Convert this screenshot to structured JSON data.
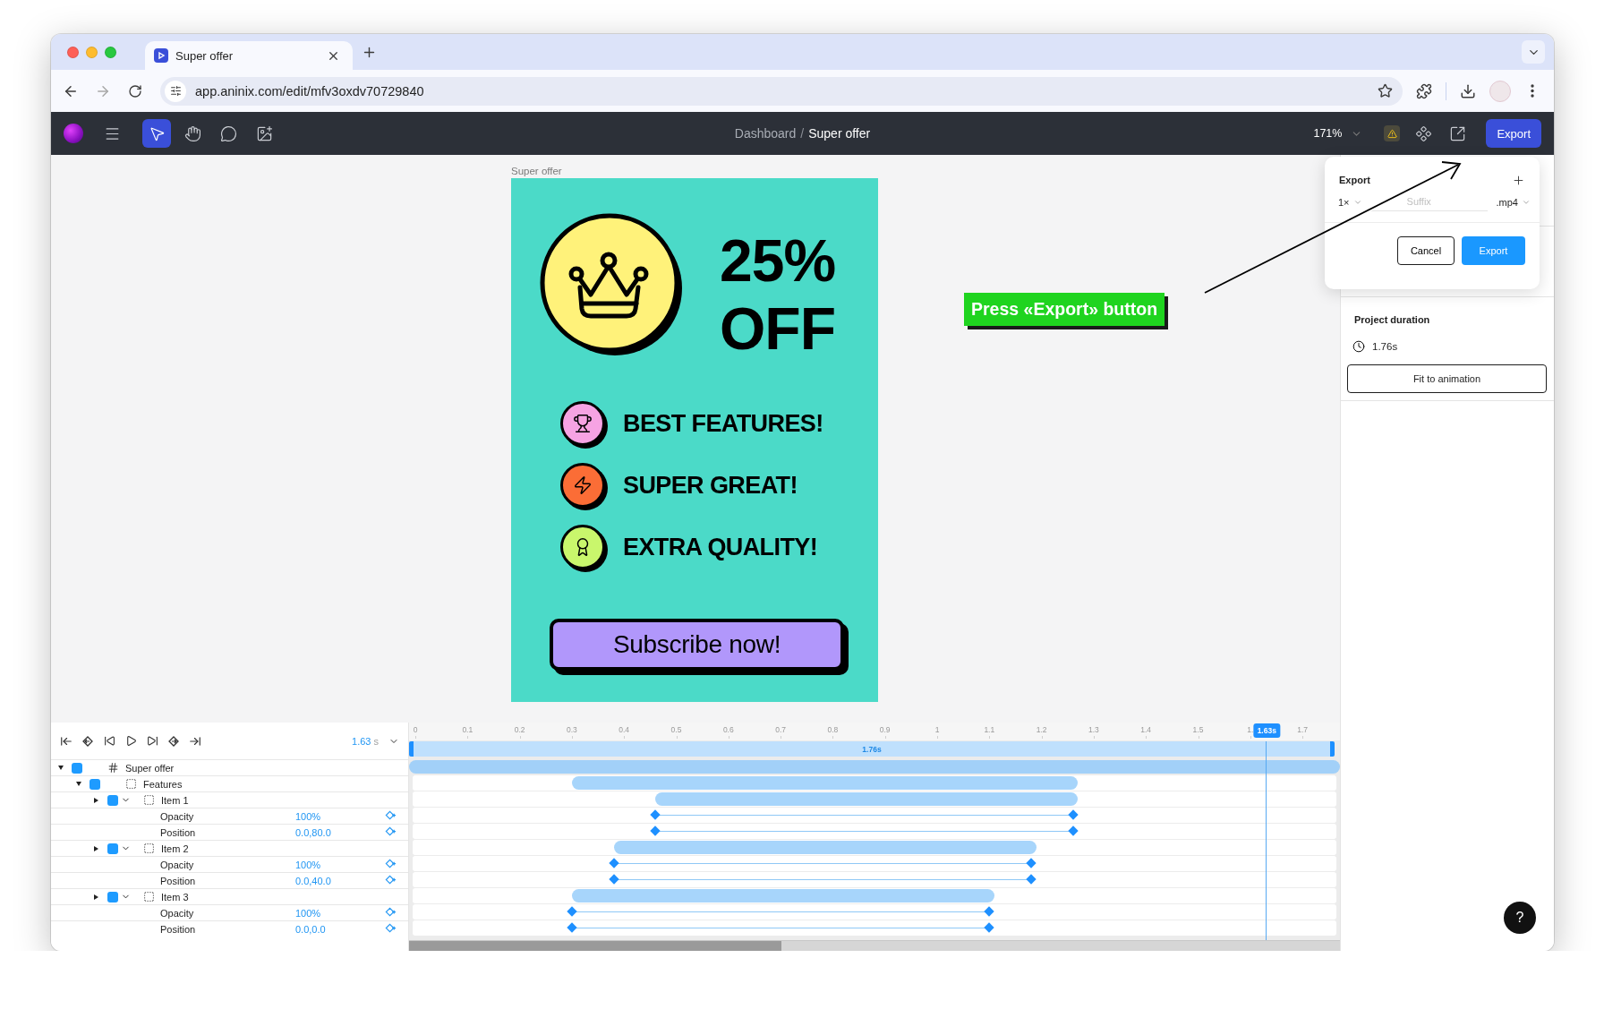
{
  "browser": {
    "tabs": [
      {
        "title": "Super offer",
        "selected": true
      }
    ],
    "forward_disabled": true,
    "url": "app.aninix.com/edit/mfv3oxdv70729840"
  },
  "toolbar": {
    "tools": [
      {
        "kind": "select",
        "selected": true
      },
      {
        "kind": "hand",
        "selected": false
      },
      {
        "kind": "comment",
        "selected": false
      },
      {
        "kind": "image",
        "selected": false
      }
    ],
    "breadcrumb": [
      {
        "label": "Dashboard",
        "selected": false
      },
      {
        "label": "Super offer",
        "selected": true
      }
    ],
    "breadcrumb_separator": "/",
    "zoom": "171%",
    "export_label": "Export"
  },
  "artboard": {
    "label": "Super offer",
    "discount": "25%",
    "off": "OFF",
    "features": [
      {
        "kind": "trophy",
        "text": "BEST FEATURES!",
        "color": "#f6a3e3"
      },
      {
        "kind": "bolt",
        "text": "SUPER GREAT!",
        "color": "#fb6d36"
      },
      {
        "kind": "award",
        "text": "EXTRA QUALITY!",
        "color": "#c9f66c"
      }
    ],
    "cta": "Subscribe now!"
  },
  "annotation": {
    "text": "Press «Export» button"
  },
  "export_popup": {
    "title": "Export",
    "scale": "1×",
    "suffix": {
      "placeholder": "Suffix"
    },
    "format": ".mp4",
    "cancel": "Cancel",
    "confirm": "Export"
  },
  "inspector": {
    "title": "Project duration",
    "duration": "1.76s",
    "button": "Fit to animation"
  },
  "timeline": {
    "current_time": "1.63",
    "time_unit": "s",
    "ruler": [
      "0",
      "0.1",
      "0.2",
      "0.3",
      "0.4",
      "0.5",
      "0.6",
      "0.7",
      "0.8",
      "0.9",
      "1",
      "1.1",
      "1.2",
      "1.3",
      "1.4",
      "1.5",
      "1.",
      "1.7"
    ],
    "duration": "1.76s",
    "playhead": "1.63s",
    "layers": [
      {
        "name": "Super offer",
        "kind": "frame",
        "expanded": true,
        "children": [
          {
            "name": "Features",
            "kind": "group",
            "expanded": true,
            "children": [
              {
                "name": "Item 1",
                "kind": "group",
                "expanded": false,
                "properties_open": true,
                "properties": [
                  {
                    "name": "Opacity",
                    "value": "100%"
                  },
                  {
                    "name": "Position",
                    "value": "0.0,80.0"
                  }
                ]
              },
              {
                "name": "Item 2",
                "kind": "group",
                "expanded": false,
                "properties_open": true,
                "properties": [
                  {
                    "name": "Opacity",
                    "value": "100%"
                  },
                  {
                    "name": "Position",
                    "value": "0.0,40.0"
                  }
                ]
              },
              {
                "name": "Item 3",
                "kind": "group",
                "expanded": false,
                "properties_open": true,
                "properties": [
                  {
                    "name": "Opacity",
                    "value": "100%"
                  },
                  {
                    "name": "Position",
                    "value": "0.0,0.0"
                  }
                ]
              }
            ]
          }
        ]
      }
    ]
  },
  "help": "?"
}
